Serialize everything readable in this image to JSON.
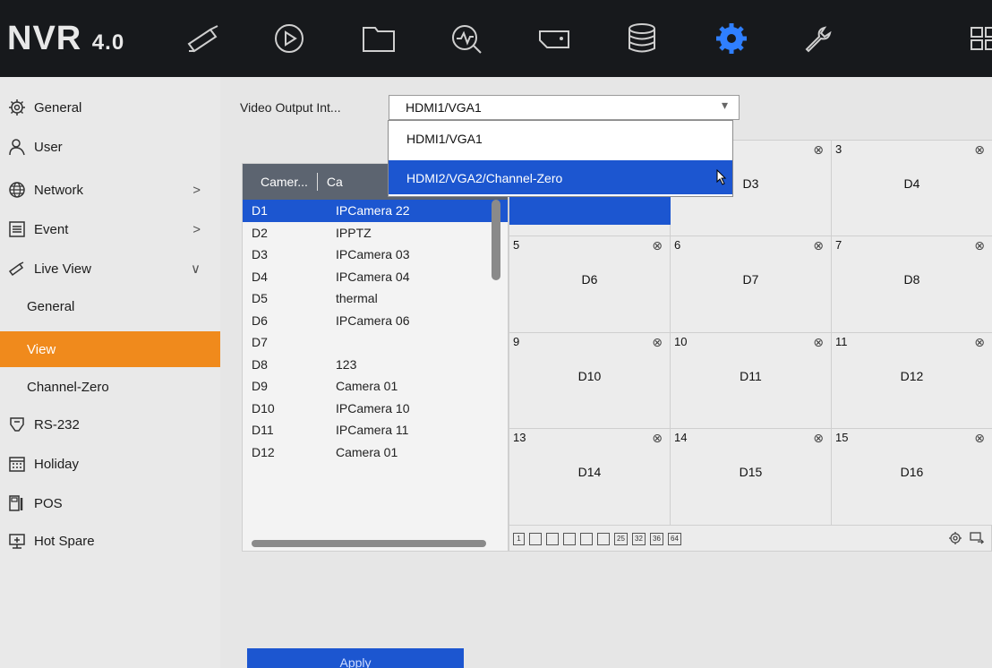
{
  "app": {
    "logo": "NVR",
    "version": "4.0"
  },
  "topbar": {
    "icons": [
      "live-view-camera-icon",
      "playback-icon",
      "file-folder-icon",
      "smart-analysis-icon",
      "camera-management-icon",
      "storage-icon",
      "configuration-gear-icon",
      "maintenance-wrench-icon",
      "grid-layout-icon"
    ],
    "active": "configuration-gear-icon",
    "accent": "#2f7fff"
  },
  "sidebar": {
    "items": [
      {
        "label": "General",
        "icon": "gear-icon"
      },
      {
        "label": "User",
        "icon": "user-icon"
      },
      {
        "label": "Network",
        "icon": "globe-icon",
        "arrow": ">"
      },
      {
        "label": "Event",
        "icon": "event-list-icon",
        "arrow": ">"
      },
      {
        "label": "Live View",
        "icon": "camera-icon",
        "arrow": "∨"
      },
      {
        "label": "General",
        "sub": true
      },
      {
        "label": "View",
        "sub": true,
        "active": true
      },
      {
        "label": "Channel-Zero",
        "sub": true
      },
      {
        "label": "RS-232",
        "icon": "serial-port-icon"
      },
      {
        "label": "Holiday",
        "icon": "calendar-icon"
      },
      {
        "label": "POS",
        "icon": "pos-icon"
      },
      {
        "label": "Hot Spare",
        "icon": "hot-spare-icon"
      }
    ],
    "active_color": "#f08a1c"
  },
  "video_output": {
    "label": "Video Output Int...",
    "value": "HDMI1/VGA1",
    "caret": "▾",
    "options": [
      "HDMI1/VGA1",
      "HDMI2/VGA2/Channel-Zero"
    ],
    "highlighted": "HDMI2/VGA2/Channel-Zero"
  },
  "camera_list": {
    "headers": [
      "Camer...",
      "Ca"
    ],
    "rows": [
      [
        "D1",
        "IPCamera 22"
      ],
      [
        "D2",
        "IPPTZ"
      ],
      [
        "D3",
        "IPCamera 03"
      ],
      [
        "D4",
        "IPCamera 04"
      ],
      [
        "D5",
        "thermal"
      ],
      [
        "D6",
        "IPCamera 06"
      ],
      [
        "D7",
        ""
      ],
      [
        "D8",
        "123"
      ],
      [
        "D9",
        "Camera 01"
      ],
      [
        "D10",
        "IPCamera 10"
      ],
      [
        "D11",
        "IPCamera 11"
      ],
      [
        "D12",
        "Camera 01"
      ]
    ],
    "selected_row": 0
  },
  "grid": {
    "close_glyph": "⊗",
    "cells": [
      {
        "num": "",
        "label": ""
      },
      {
        "num": "",
        "label": "D3"
      },
      {
        "num": "3",
        "label": "D4"
      },
      {
        "num": "5",
        "label": "D6"
      },
      {
        "num": "6",
        "label": "D7"
      },
      {
        "num": "7",
        "label": "D8"
      },
      {
        "num": "9",
        "label": "D10"
      },
      {
        "num": "10",
        "label": "D11"
      },
      {
        "num": "11",
        "label": "D12"
      },
      {
        "num": "13",
        "label": "D14"
      },
      {
        "num": "14",
        "label": "D15"
      },
      {
        "num": "15",
        "label": "D16"
      }
    ]
  },
  "layout_toolbar": {
    "layouts": [
      "1",
      "4",
      "6",
      "8",
      "9",
      "16",
      "25",
      "32",
      "36",
      "64"
    ]
  },
  "apply_button": {
    "label": "Apply"
  }
}
